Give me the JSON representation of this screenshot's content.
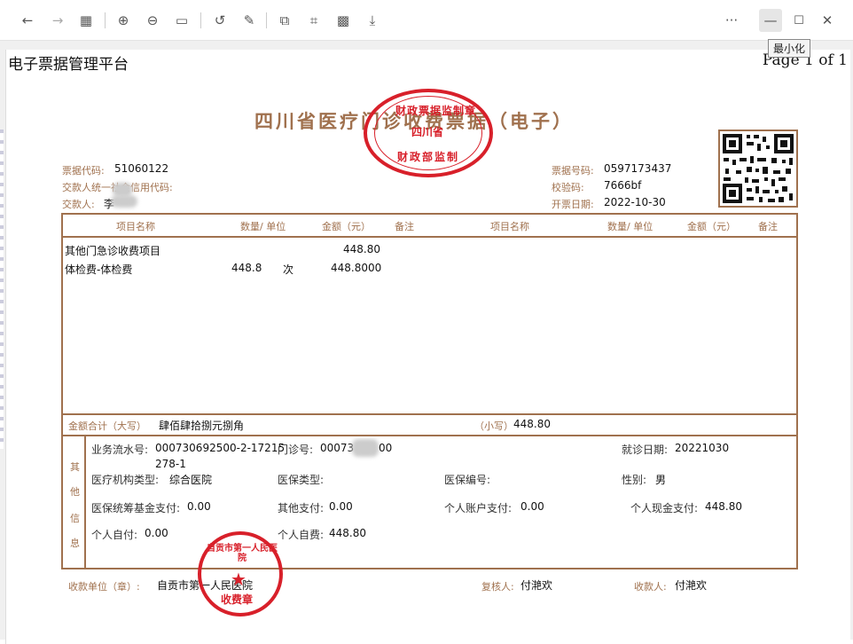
{
  "toolbar": {
    "back": "←",
    "forward": "→",
    "thumbnails": "▦",
    "zoom_in": "⊕",
    "zoom_out": "⊖",
    "fit": "▭",
    "rotate": "↺",
    "annotate": "✎",
    "copy": "⧉",
    "select": "⌗",
    "qr": "▩",
    "download": "⤓",
    "more": "···",
    "minimize": "—",
    "maximize": "☐",
    "close": "✕",
    "tooltip": "最小化"
  },
  "page_header": {
    "title": "电子票据管理平台",
    "page": "Page 1 of 1"
  },
  "invoice": {
    "title": "四川省医疗门诊收费票据（电子）",
    "code_label": "票据代码:",
    "code": "51060122",
    "credit_label": "交款人统一社会信用代码:",
    "payer_label": "交款人:",
    "payer": "李",
    "number_label": "票据号码:",
    "number": "0597173437",
    "check_label": "校验码:",
    "check": "7666bf",
    "date_label": "开票日期:",
    "date": "2022-10-30",
    "columns": [
      "项目名称",
      "数量/ 单位",
      "金额（元）",
      "备注",
      "项目名称",
      "数量/ 单位",
      "金额（元）",
      "备注"
    ],
    "items": [
      {
        "name": "其他门急诊收费项目",
        "qty": "",
        "unit": "",
        "amount": "448.80"
      },
      {
        "name": "体检费-体检费",
        "qty": "448.8",
        "unit": "次",
        "amount": "448.8000"
      }
    ],
    "total_label": "金额合计（大写）",
    "total_upper": "肆佰肆拾捌元捌角",
    "total_small_label": "（小写）",
    "total_small": "448.80",
    "other_label": [
      "其",
      "他",
      "信",
      "息"
    ],
    "serial_label": "业务流水号:",
    "serial": "000730692500-2-17215",
    "serial2": "278-1",
    "clinic_label": "门诊号:",
    "clinic_a": "00073",
    "clinic_b": "00",
    "visit_label": "就诊日期:",
    "visit": "20221030",
    "org_type_label": "医疗机构类型:",
    "org_type": "综合医院",
    "ins_type_label": "医保类型:",
    "ins_no_label": "医保编号:",
    "sex_label": "性别:",
    "sex": "男",
    "fund_label": "医保统筹基金支付:",
    "fund": "0.00",
    "other_pay_label": "其他支付:",
    "other_pay": "0.00",
    "acct_label": "个人账户支付:",
    "acct": "0.00",
    "cash_label": "个人现金支付:",
    "cash": "448.80",
    "self_pay_label": "个人自付:",
    "self_pay": "0.00",
    "self_fee_label": "个人自费:",
    "self_fee": "448.80",
    "unit_label": "收款单位（章）:",
    "unit": "自贡市第一人民医院",
    "reviewer_label": "复核人:",
    "reviewer": "付滟欢",
    "cashier_label": "收款人:",
    "cashier": "付滟欢"
  },
  "seal_top": {
    "outer": "财政票据监制章",
    "inner": "四川省",
    "bottom": "财政部监制"
  },
  "seal_bottom": {
    "outer": "自贡市第一人民医院",
    "bottom": "收费章"
  },
  "colors": {
    "brown": "#a0714e",
    "seal": "#d8202a"
  }
}
